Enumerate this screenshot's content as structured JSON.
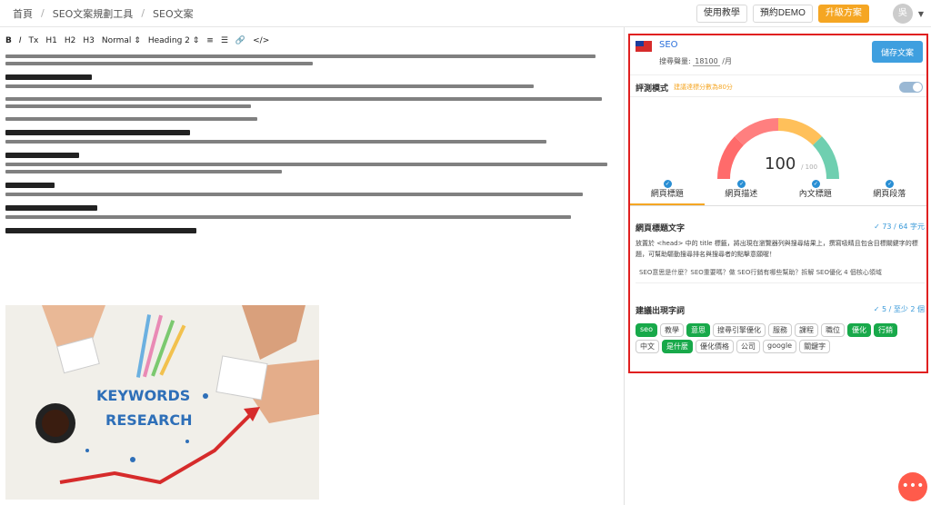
{
  "breadcrumb": [
    "首頁",
    "SEO文案規劃工具",
    "SEO文案"
  ],
  "top_buttons": {
    "tutorial": "使用教學",
    "demo": "預約DEMO",
    "upgrade": "升級方案"
  },
  "avatar_text": "吳",
  "toolbar": {
    "bold": "B",
    "italic": "I",
    "clear": "Tx",
    "h1": "H1",
    "h2": "H2",
    "h3": "H3",
    "style1": "Normal",
    "style2": "Heading 2"
  },
  "panel": {
    "keyword": "SEO",
    "volume_label": "搜尋聲量:",
    "volume_value": "18100",
    "volume_unit": "/月",
    "save_label": "儲存文案",
    "mode_title": "評測模式",
    "mode_hint": "建議達標分數為80分",
    "score": "100",
    "score_max": "/ 100",
    "tabs": [
      "網頁標題",
      "網頁描述",
      "內文標題",
      "網頁段落"
    ],
    "title_section": {
      "heading": "網頁標題文字",
      "count": "73 / 64 字元",
      "desc": "放置於 <head> 中的 title 標籤，將出現在瀏覽器列與搜尋結果上，撰寫吸睛且包含目標關鍵字的標題，可幫助驅動搜尋排名與搜尋者的點擊意願喔！",
      "value": "SEO意思是什麼？SEO重要嗎？做 SEO行銷有哪些幫助？拆解 SEO優化 4 個核心領域"
    },
    "words_section": {
      "heading": "建議出現字詞",
      "count": "5 / 至少 2 個",
      "chips": [
        {
          "t": "seo",
          "on": true
        },
        {
          "t": "教學",
          "on": false
        },
        {
          "t": "意思",
          "on": true
        },
        {
          "t": "搜尋引擎優化",
          "on": false
        },
        {
          "t": "服務",
          "on": false
        },
        {
          "t": "課程",
          "on": false
        },
        {
          "t": "職位",
          "on": false
        },
        {
          "t": "優化",
          "on": true
        },
        {
          "t": "行銷",
          "on": true
        },
        {
          "t": "中文",
          "on": false
        },
        {
          "t": "是什麼",
          "on": true
        },
        {
          "t": "優化價格",
          "on": false
        },
        {
          "t": "公司",
          "on": false
        },
        {
          "t": "google",
          "on": false
        },
        {
          "t": "關鍵字",
          "on": false
        }
      ]
    }
  },
  "hero_text": {
    "line1": "KEYWORDS",
    "line2": "RESEARCH"
  },
  "fab_label": "•••"
}
